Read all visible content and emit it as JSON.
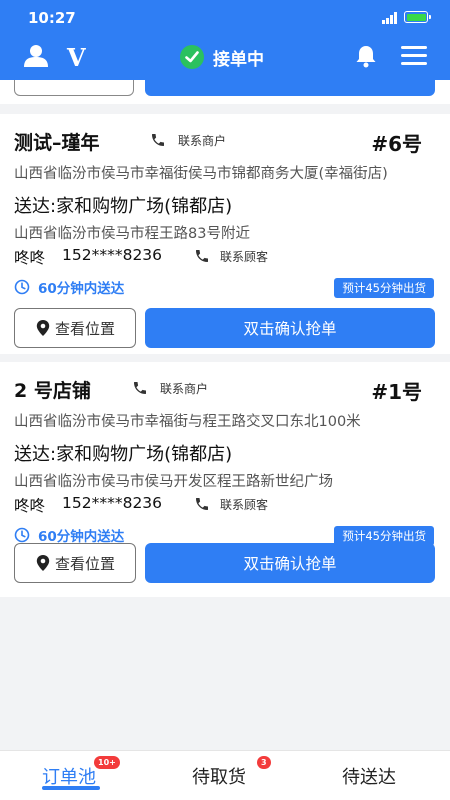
{
  "status_bar": {
    "time": "10:27"
  },
  "header": {
    "status_label": "接单中"
  },
  "orders": [
    {
      "shop_name": "测试–瑾年",
      "contact_merchant": "联系商户",
      "order_no": "#6号",
      "shop_address": "山西省临汾市侯马市幸福街侯马市锦都商务大厦(幸福街店)",
      "deliver_to": "送达:家和购物广场(锦都店)",
      "deliver_address": "山西省临汾市侯马市程王路83号附近",
      "customer_name": "咚咚",
      "customer_phone": "152****8236",
      "contact_customer": "联系顾客",
      "time_limit": "60分钟内送达",
      "eta": "预计45分钟出货",
      "view_location": "查看位置",
      "grab_button": "双击确认抢单"
    },
    {
      "shop_name": "2 号店铺",
      "contact_merchant": "联系商户",
      "order_no": "#1号",
      "shop_address": "山西省临汾市侯马市幸福街与程王路交叉口东北100米",
      "deliver_to": "送达:家和购物广场(锦都店)",
      "deliver_address": "山西省临汾市侯马市侯马开发区程王路新世纪广场",
      "customer_name": "咚咚",
      "customer_phone": "152****8236",
      "contact_customer": "联系顾客",
      "time_limit": "60分钟内送达",
      "eta": "预计45分钟出货",
      "view_location": "查看位置",
      "grab_button": "双击确认抢单"
    }
  ],
  "tabs": [
    {
      "label": "订单池",
      "badge": "10+"
    },
    {
      "label": "待取货",
      "badge": "3"
    },
    {
      "label": "待送达",
      "badge": ""
    }
  ],
  "colors": {
    "primary": "#2f7ef4",
    "online_green": "#2bc15f",
    "badge_red": "#f33b3b"
  }
}
